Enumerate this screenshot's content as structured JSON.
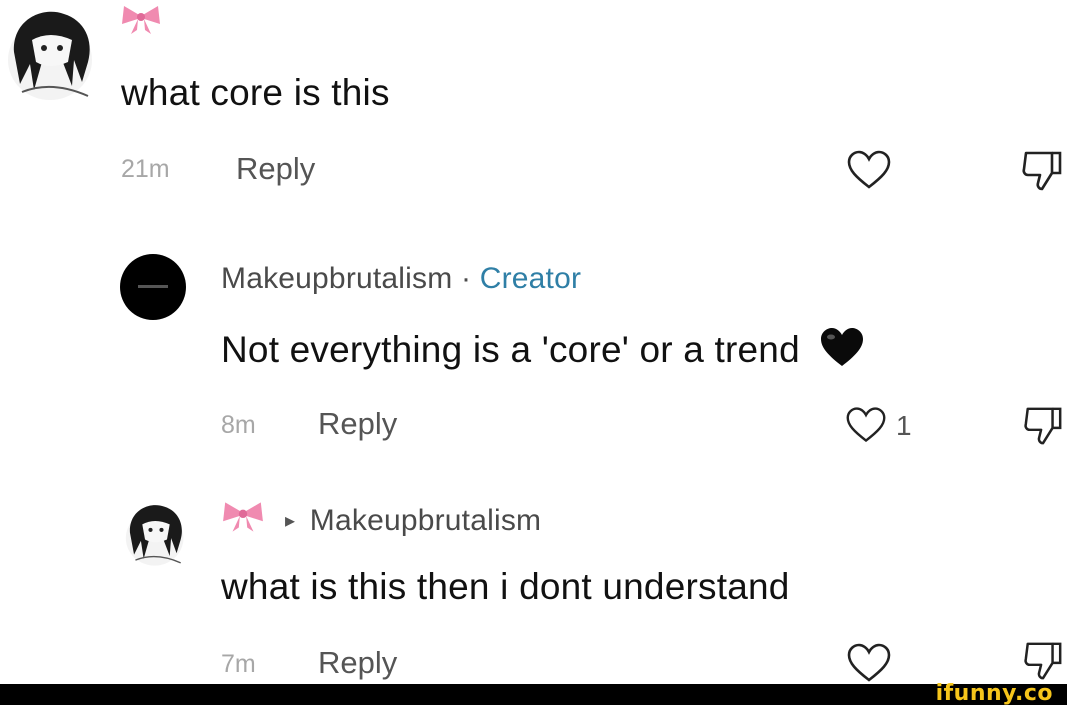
{
  "comments": [
    {
      "avatar": "anime-girl-sketch-avatar",
      "username_icon": "pink-bow-icon",
      "text": "what core is this",
      "time": "21m",
      "reply_label": "Reply",
      "likes": null
    },
    {
      "avatar": "black-circle-logo-avatar",
      "username": "Makeupbrutalism",
      "separator": "·",
      "badge": "Creator",
      "text": "Not everything is a 'core' or a trend",
      "emoji": "black-heart-emoji",
      "time": "8m",
      "reply_label": "Reply",
      "likes": "1"
    },
    {
      "avatar": "anime-girl-sketch-avatar",
      "username_icon": "pink-bow-icon",
      "reply_arrow": "▸",
      "reply_to": "Makeupbrutalism",
      "text": "what is this then i dont understand",
      "time": "7m",
      "reply_label": "Reply",
      "likes": null
    }
  ],
  "watermark": "ifunny.co",
  "colors": {
    "creator_badge": "#2f7fa6",
    "bow": "#f08ab0",
    "watermark": "#f6c51b",
    "footer": "#000000"
  }
}
